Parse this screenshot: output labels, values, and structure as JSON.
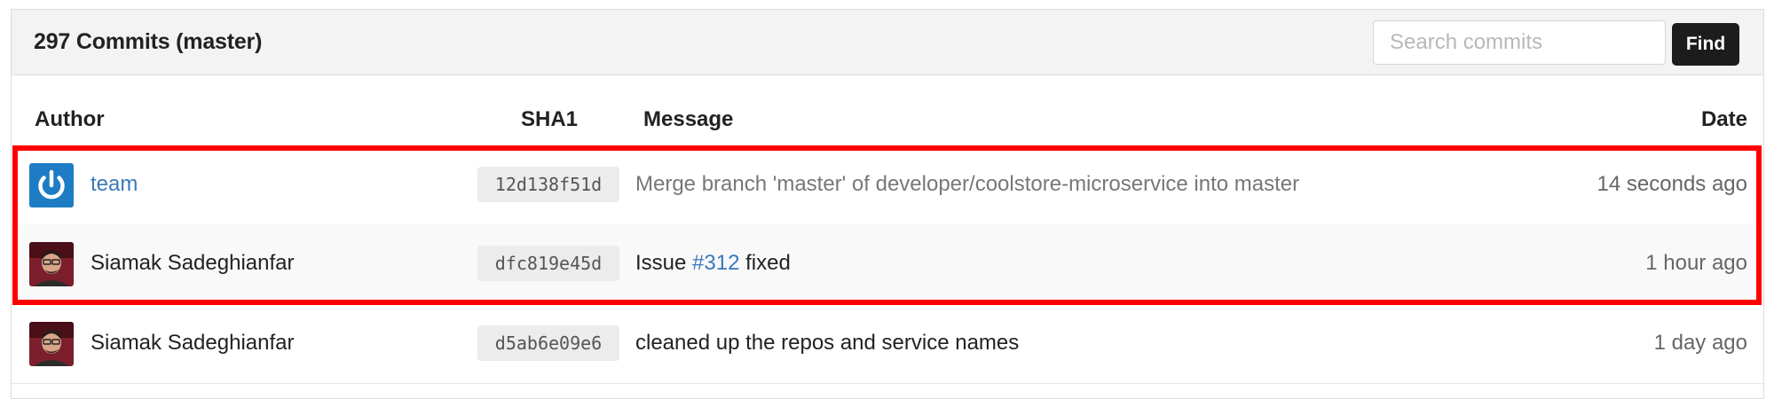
{
  "header": {
    "title": "297 Commits (master)",
    "search_placeholder": "Search commits",
    "search_value": "",
    "find_label": "Find"
  },
  "columns": {
    "author": "Author",
    "sha": "SHA1",
    "message": "Message",
    "date": "Date"
  },
  "commits": [
    {
      "author": "team",
      "author_is_link": true,
      "avatar": "power-icon",
      "sha": "12d138f51d",
      "message": "Merge branch 'master' of developer/coolstore-microservice into master",
      "date": "14 seconds ago"
    },
    {
      "author": "Siamak Sadeghianfar",
      "avatar": "user-photo",
      "sha": "dfc819e45d",
      "message_prefix": "Issue ",
      "issue_ref": "#312",
      "message_suffix": " fixed",
      "date": "1 hour ago"
    },
    {
      "author": "Siamak Sadeghianfar",
      "avatar": "user-photo",
      "sha": "d5ab6e09e6",
      "message": "cleaned up the repos and service names",
      "date": "1 day ago"
    }
  ],
  "colors": {
    "link": "#3a78bb",
    "highlight": "#ff0000",
    "find_button": "#1c1c1c",
    "team_avatar": "#1d7cc4"
  }
}
